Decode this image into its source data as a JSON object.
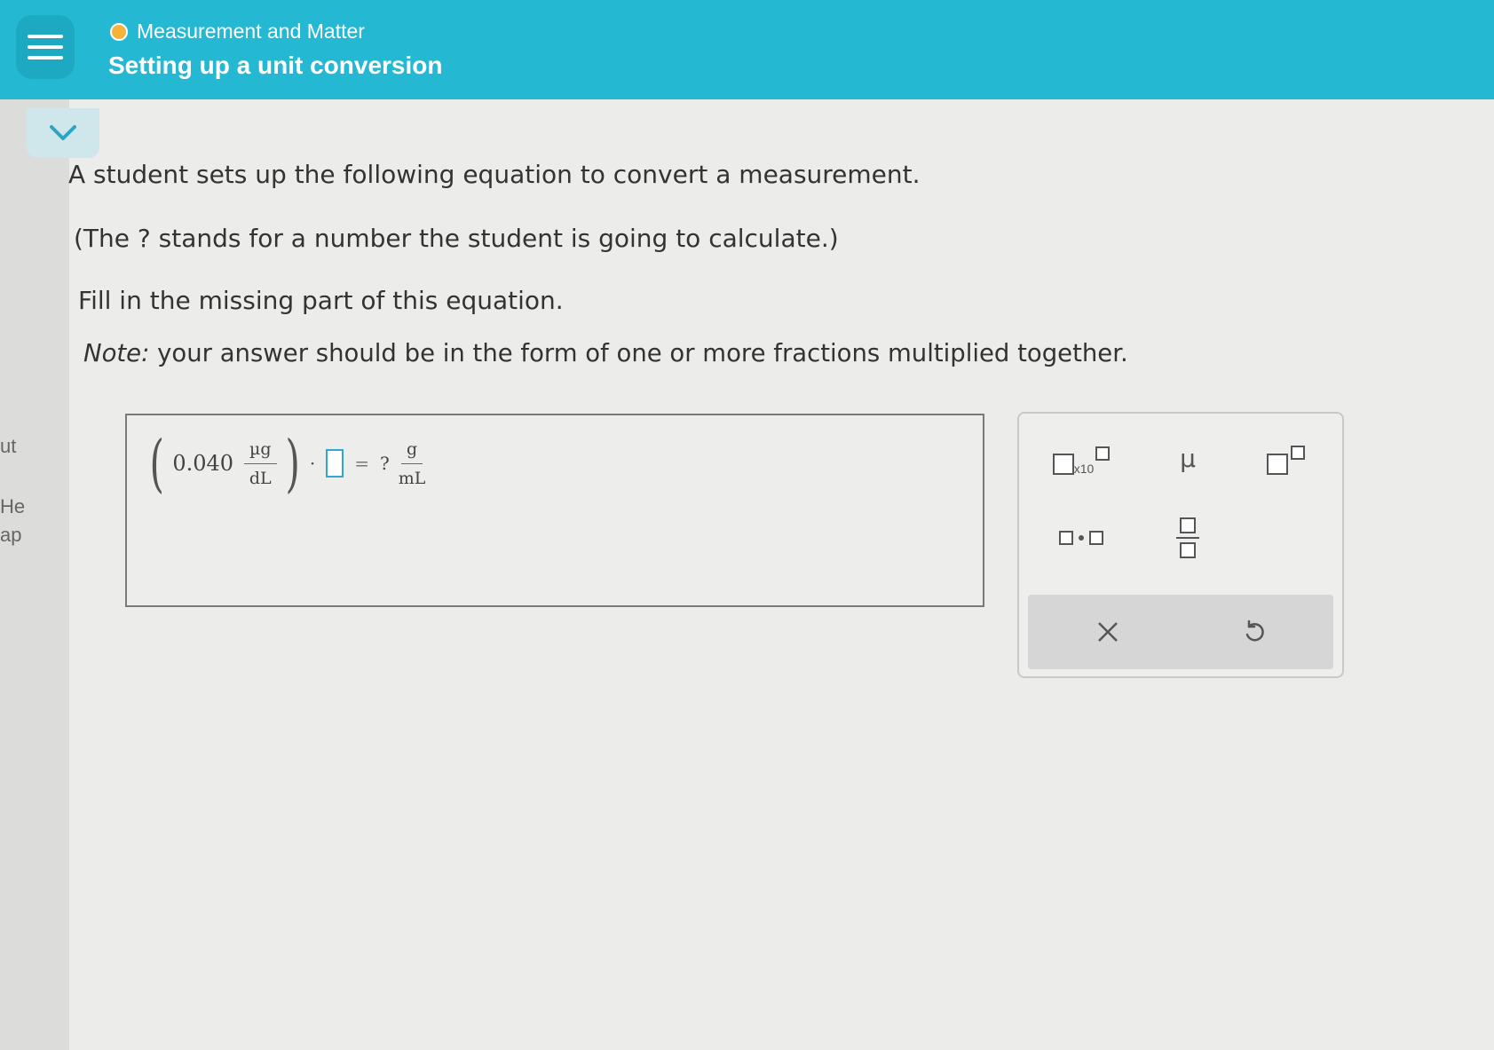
{
  "header": {
    "topic": "Measurement and Matter",
    "title": "Setting up a unit conversion"
  },
  "edge_fragments": [
    "ut",
    "He",
    "ap"
  ],
  "question": {
    "line1": "A student sets up the following equation to convert a measurement.",
    "line2": "(The ? stands for a number the student is going to calculate.)",
    "line3": "Fill in the missing part of this equation.",
    "note_label": "Note:",
    "note_text": " your answer should be in the form of one or more fractions multiplied together."
  },
  "equation": {
    "value": "0.040",
    "unit_numerator": "µg",
    "unit_denominator": "dL",
    "dot": "·",
    "equals": "=",
    "unknown": "?",
    "result_numerator": "g",
    "result_denominator": "mL"
  },
  "palette": {
    "sci_notation_label": "x10",
    "mu_label": "µ",
    "tools": [
      "sci-notation",
      "micro-symbol",
      "superscript",
      "multiply-dot",
      "fraction"
    ],
    "actions": [
      "clear",
      "undo"
    ]
  },
  "colors": {
    "header": "#25b8d2",
    "accent_dot": "#f5b33a",
    "slot_border": "#2fa7d0"
  }
}
